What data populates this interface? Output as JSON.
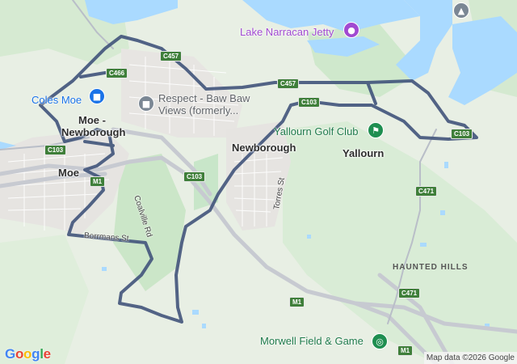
{
  "map": {
    "towns": {
      "moe_newborough_line1": "Moe -",
      "moe_newborough_line2": "Newborough",
      "moe": "Moe",
      "newborough": "Newborough",
      "yallourn": "Yallourn"
    },
    "pois": {
      "lake_narracan_jetty": "Lake Narracan Jetty",
      "respect_line1": "Respect - Baw Baw",
      "respect_line2": "Views (formerly...",
      "coles_moe": "Coles Moe",
      "yallourn_golf_club": "Yallourn Golf Club",
      "morwell_field_game": "Morwell Field & Game"
    },
    "streets": {
      "borrmans_st": "Borrmans St",
      "coalville_rd": "Coalville Rd",
      "torres_st": "Torres St"
    },
    "regions": {
      "haunted_hills": "HAUNTED HILLS"
    },
    "route_shields": {
      "c457": "C457",
      "c466": "C466",
      "c103_west": "C103",
      "c103_centre": "C103",
      "c103_north": "C103",
      "c103_east": "C103",
      "m1_west": "M1",
      "m1_centre": "M1",
      "m1_south": "M1",
      "c471_north": "C471",
      "c471_south": "C471"
    },
    "icons": {
      "jetty": "camera-icon",
      "respect": "landmark-icon",
      "coles": "shopping-cart-icon",
      "golf": "golf-icon",
      "field_game": "target-icon",
      "school": "graduation-cap-icon"
    },
    "colors": {
      "water": "#aadaff",
      "route_line": "#44577d",
      "shield": "#3f7f3a",
      "park": "#c8e6c9"
    },
    "logo": "Google",
    "attribution": "Map data ©2026 Google"
  }
}
